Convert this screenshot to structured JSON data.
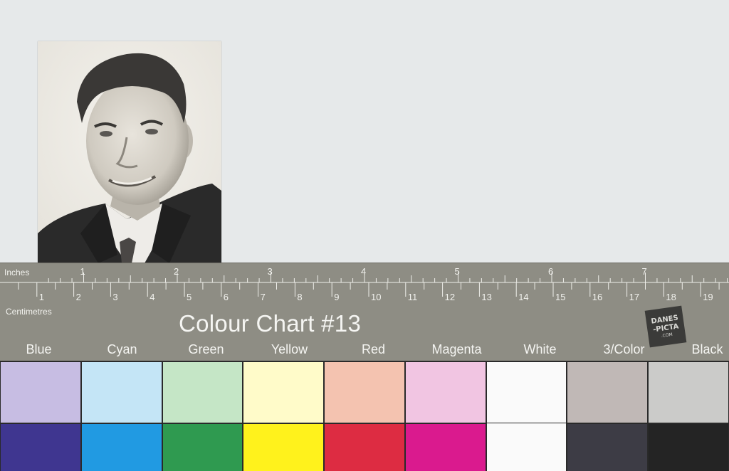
{
  "ruler": {
    "inches_label": "Inches",
    "cm_label": "Centimetres",
    "inch_numbers": [
      "1",
      "2",
      "3",
      "4",
      "5",
      "6",
      "7"
    ],
    "cm_numbers": [
      "1",
      "2",
      "3",
      "4",
      "5",
      "6",
      "7",
      "8",
      "9",
      "10",
      "11",
      "12",
      "13",
      "14",
      "15",
      "16",
      "17",
      "18",
      "19"
    ]
  },
  "chart": {
    "title": "Colour Chart #13",
    "logo": {
      "line1": "DANES",
      "line2": "-PICTA",
      "line3": ".COM"
    },
    "labels": [
      "Blue",
      "Cyan",
      "Green",
      "Yellow",
      "Red",
      "Magenta",
      "White",
      "3/Color",
      "Black"
    ],
    "light_colors": [
      "#c7bde3",
      "#c4e5f6",
      "#c5e6c6",
      "#fffbc9",
      "#f4c3b0",
      "#f1c5e2",
      "#fafafa",
      "#c0b8b6",
      "#cbcbc9"
    ],
    "dark_colors": [
      "#3f3690",
      "#219ae2",
      "#2f9a50",
      "#fff21c",
      "#dd2c42",
      "#da1a8e",
      "#fafafa",
      "#3d3c45",
      "#242424"
    ]
  }
}
